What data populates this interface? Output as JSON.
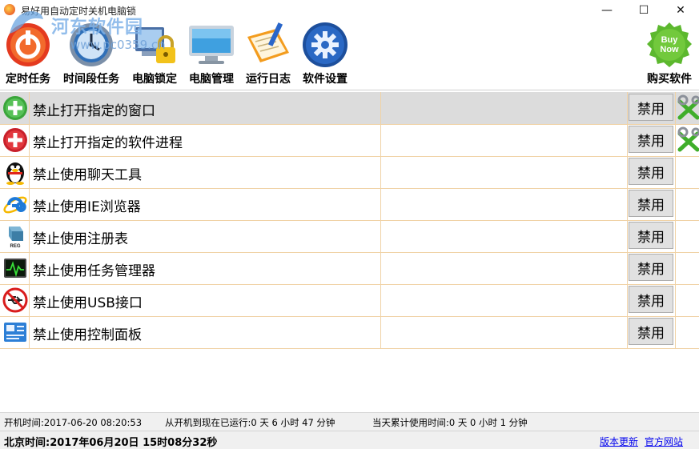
{
  "window": {
    "title": "易好用自动定时关机电脑锁",
    "controls": {
      "minimize": "—",
      "maximize": "☐",
      "close": "✕"
    }
  },
  "watermark": {
    "site_name": "河东软件园",
    "url": "www.pc0359.cn"
  },
  "toolbar": {
    "items": [
      {
        "label": "定时任务",
        "icon": "power-clock-icon"
      },
      {
        "label": "时间段任务",
        "icon": "clock-icon"
      },
      {
        "label": "电脑锁定",
        "icon": "computer-lock-icon"
      },
      {
        "label": "电脑管理",
        "icon": "monitor-icon"
      },
      {
        "label": "运行日志",
        "icon": "log-book-icon"
      },
      {
        "label": "软件设置",
        "icon": "gear-icon"
      },
      {
        "label": "购买软件",
        "icon": "buy-now-icon",
        "badge": "Buy Now"
      }
    ]
  },
  "list": {
    "rows": [
      {
        "label": "禁止打开指定的窗口",
        "button": "禁用",
        "icon": "add-icon",
        "has_tools": true,
        "selected": true
      },
      {
        "label": "禁止打开指定的软件进程",
        "button": "禁用",
        "icon": "medical-cross-icon",
        "has_tools": true,
        "selected": false
      },
      {
        "label": "禁止使用聊天工具",
        "button": "禁用",
        "icon": "penguin-icon",
        "has_tools": false,
        "selected": false
      },
      {
        "label": "禁止使用IE浏览器",
        "button": "禁用",
        "icon": "ie-browser-icon",
        "has_tools": false,
        "selected": false
      },
      {
        "label": "禁止使用注册表",
        "button": "禁用",
        "icon": "registry-cube-icon",
        "has_tools": false,
        "selected": false
      },
      {
        "label": "禁止使用任务管理器",
        "button": "禁用",
        "icon": "task-monitor-icon",
        "has_tools": false,
        "selected": false
      },
      {
        "label": "禁止使用USB接口",
        "button": "禁用",
        "icon": "no-usb-icon",
        "has_tools": false,
        "selected": false
      },
      {
        "label": "禁止使用控制面板",
        "button": "禁用",
        "icon": "control-panel-icon",
        "has_tools": false,
        "selected": false
      }
    ]
  },
  "status": {
    "boot_time": "开机时间:2017-06-20 08:20:53",
    "uptime": "从开机到现在已运行:0 天 6 小时 47 分钟",
    "daily_usage": "当天累计使用时间:0 天 0 小时 1 分钟",
    "beijing_time": "北京时间:2017年06月20日 15时08分32秒",
    "update_link": "版本更新",
    "website_link": "官方网站"
  },
  "colors": {
    "row_border": "#f0d2a6",
    "selected_row": "#dcdcdc",
    "link": "#0000ee",
    "status_bg": "#f0f0f0"
  }
}
